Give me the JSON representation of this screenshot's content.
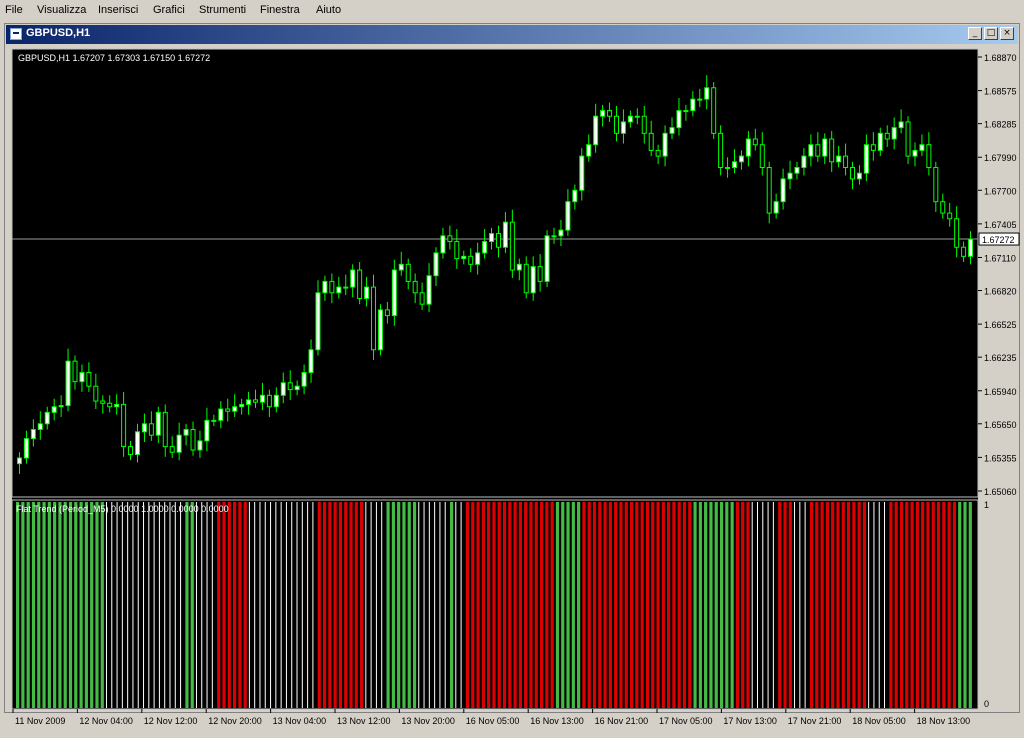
{
  "menu": {
    "items": [
      {
        "label": "File"
      },
      {
        "label": "Visualizza"
      },
      {
        "label": "Inserisci"
      },
      {
        "label": "Grafici"
      },
      {
        "label": "Strumenti"
      },
      {
        "label": "Finestra"
      },
      {
        "label": "Aiuto"
      }
    ]
  },
  "window": {
    "title": "GBPUSD,H1",
    "minimize_label": "_",
    "maximize_label": "□",
    "close_label": "×"
  },
  "chart_data": {
    "type": "candlestick",
    "symbol_info": "GBPUSD,H1  1.67207 1.67303 1.67150 1.67272",
    "current_price": "1.67272",
    "y_ticks": [
      "1.68870",
      "1.68575",
      "1.68285",
      "1.67990",
      "1.67700",
      "1.67405",
      "1.67110",
      "1.66820",
      "1.66525",
      "1.66235",
      "1.65940",
      "1.65650",
      "1.65355",
      "1.65060"
    ],
    "ylim": [
      1.6506,
      1.6887
    ],
    "x_labels": [
      "11 Nov 2009",
      "12 Nov 04:00",
      "12 Nov 12:00",
      "12 Nov 20:00",
      "13 Nov 04:00",
      "13 Nov 12:00",
      "13 Nov 20:00",
      "16 Nov 05:00",
      "16 Nov 13:00",
      "16 Nov 21:00",
      "17 Nov 05:00",
      "17 Nov 13:00",
      "17 Nov 21:00",
      "18 Nov 05:00",
      "18 Nov 13:00"
    ],
    "close": [
      1.6535,
      1.6552,
      1.656,
      1.6565,
      1.6575,
      1.658,
      1.6581,
      1.662,
      1.6602,
      1.661,
      1.6598,
      1.6585,
      1.6583,
      1.658,
      1.6582,
      1.6545,
      1.6538,
      1.6558,
      1.6565,
      1.6555,
      1.6575,
      1.6545,
      1.654,
      1.6555,
      1.656,
      1.6542,
      1.655,
      1.6568,
      1.6568,
      1.6578,
      1.6576,
      1.658,
      1.6582,
      1.6586,
      1.6584,
      1.659,
      1.658,
      1.659,
      1.6601,
      1.6595,
      1.6598,
      1.661,
      1.663,
      1.668,
      1.669,
      1.668,
      1.6685,
      1.6685,
      1.67,
      1.6675,
      1.6685,
      1.663,
      1.6665,
      1.666,
      1.67,
      1.6705,
      1.669,
      1.668,
      1.667,
      1.6695,
      1.6715,
      1.673,
      1.6725,
      1.671,
      1.6712,
      1.6705,
      1.6715,
      1.6725,
      1.6732,
      1.672,
      1.6742,
      1.67,
      1.6705,
      1.668,
      1.6703,
      1.669,
      1.673,
      1.673,
      1.6735,
      1.676,
      1.677,
      1.68,
      1.681,
      1.6835,
      1.684,
      1.6835,
      1.682,
      1.683,
      1.6835,
      1.6835,
      1.682,
      1.6805,
      1.68,
      1.682,
      1.6825,
      1.684,
      1.684,
      1.685,
      1.685,
      1.686,
      1.682,
      1.679,
      1.679,
      1.6795,
      1.68,
      1.6815,
      1.681,
      1.679,
      1.675,
      1.676,
      1.678,
      1.6785,
      1.679,
      1.68,
      1.681,
      1.68,
      1.6815,
      1.6795,
      1.68,
      1.679,
      1.678,
      1.6785,
      1.681,
      1.6805,
      1.682,
      1.6815,
      1.6825,
      1.683,
      1.68,
      1.6805,
      1.681,
      1.679,
      1.676,
      1.675,
      1.6745,
      1.672,
      1.6712,
      1.6727
    ],
    "open": [
      1.653,
      1.6535,
      1.6552,
      1.656,
      1.6565,
      1.6575,
      1.658,
      1.6581,
      1.662,
      1.6602,
      1.661,
      1.6598,
      1.6585,
      1.6583,
      1.658,
      1.6582,
      1.6545,
      1.6538,
      1.6558,
      1.6565,
      1.6555,
      1.6575,
      1.6545,
      1.654,
      1.6555,
      1.656,
      1.6542,
      1.655,
      1.6568,
      1.6568,
      1.6578,
      1.6576,
      1.658,
      1.6582,
      1.6586,
      1.6584,
      1.659,
      1.658,
      1.659,
      1.6601,
      1.6595,
      1.6598,
      1.661,
      1.663,
      1.668,
      1.669,
      1.668,
      1.6685,
      1.6685,
      1.67,
      1.6675,
      1.6685,
      1.663,
      1.6665,
      1.666,
      1.67,
      1.6705,
      1.669,
      1.668,
      1.667,
      1.6695,
      1.6715,
      1.673,
      1.6725,
      1.671,
      1.6712,
      1.6705,
      1.6715,
      1.6725,
      1.6732,
      1.672,
      1.6742,
      1.67,
      1.6705,
      1.668,
      1.6703,
      1.669,
      1.673,
      1.673,
      1.6735,
      1.676,
      1.677,
      1.68,
      1.681,
      1.6835,
      1.684,
      1.6835,
      1.682,
      1.683,
      1.6835,
      1.6835,
      1.682,
      1.6805,
      1.68,
      1.682,
      1.6825,
      1.684,
      1.684,
      1.685,
      1.685,
      1.686,
      1.682,
      1.679,
      1.679,
      1.6795,
      1.68,
      1.6815,
      1.681,
      1.679,
      1.675,
      1.676,
      1.678,
      1.6785,
      1.679,
      1.68,
      1.681,
      1.68,
      1.6815,
      1.6795,
      1.68,
      1.679,
      1.678,
      1.6785,
      1.681,
      1.6805,
      1.682,
      1.6815,
      1.6825,
      1.683,
      1.68,
      1.6805,
      1.681,
      1.679,
      1.676,
      1.675,
      1.6745,
      1.672,
      1.6712
    ],
    "hist_colors": "GGGGGGGGGGGGGGGGGWWWWWWWWWWWWWWWGGWWWWRRRRRRWWWWWWWWWWWWWRRRRRRRRRWWWWGGGGGGWWWWWWGWWRRRRRRRRRRRRRRRRRGGGGGRRRRRRRRRRRRRRRRRRRRRGGGGGGGGRRRWWWWWRRRWWWRRRRRRRRRRRWWWWRRRRRRRRRRRRRGGG",
    "hist_values": [
      1,
      0
    ],
    "indicator_label": "Flat Trend (Period_M5) 0.0000 1.0000 0.0000 0.0000",
    "ind_y_top": "1",
    "ind_y_bottom": "0",
    "colors": {
      "up_candle": "#ffffff",
      "down_candle": "#000000",
      "wick": "#00ff00",
      "bull": "#44bb44",
      "bear": "#dd0000",
      "neutral": "#ffffff",
      "grid": "#c0c0c0",
      "background": "#000000"
    }
  }
}
